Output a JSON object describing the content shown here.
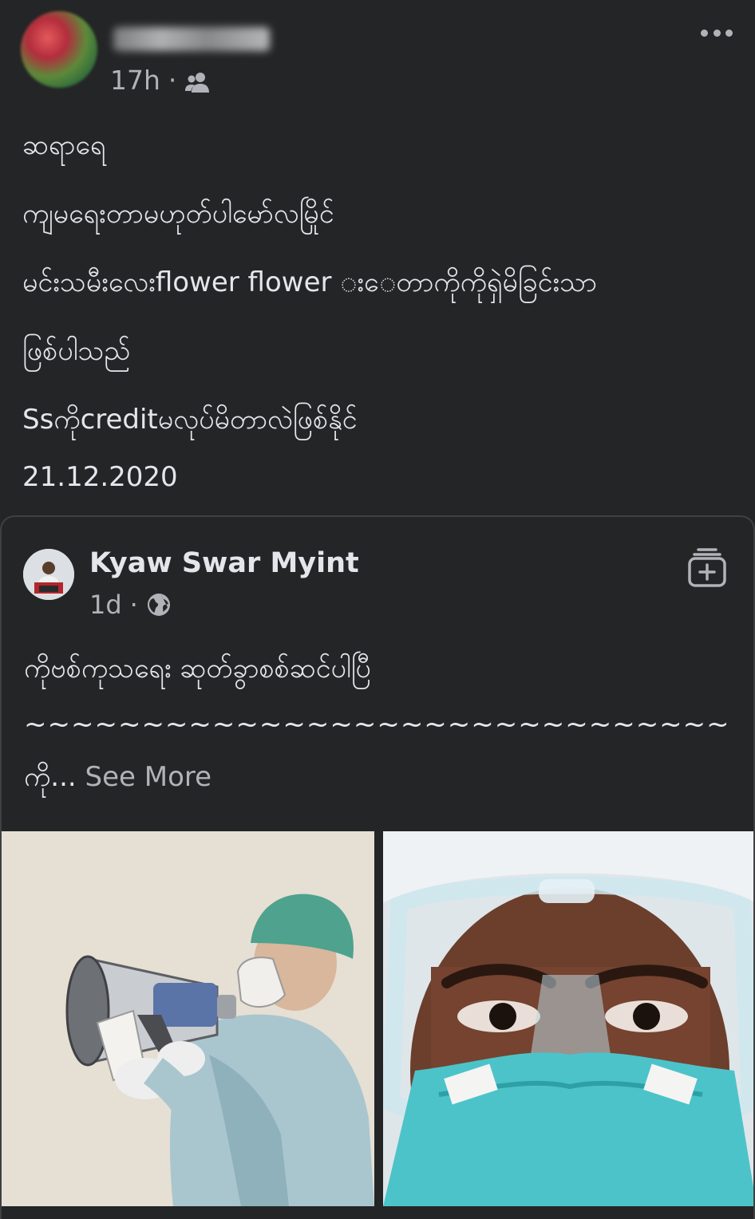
{
  "post": {
    "time": "17h",
    "separator": "·",
    "audience_icon": "friends-icon",
    "more_icon": "more-options-icon",
    "lines": [
      "ဆရာရေ",
      "ကျမရေးတာမဟုတ်ပါမော်လမြိုင်",
      "မင်းသမီးလေးflower flower းေတာကိုကိုရှဲမိခြင်းသာ",
      "ဖြစ်ပါသည်",
      "Ssကိုcreditမလုပ်မိတာလဲဖြစ်နိုင်",
      "21.12.2020"
    ]
  },
  "shared": {
    "author": "Kyaw Swar Myint",
    "time": "1d",
    "separator": "·",
    "audience_icon": "globe-icon",
    "save_icon": "save-collection-icon",
    "line1": "ကိုဗစ်ကုသရေး ဆုတ်ခွာစစ်ဆင်ပါပြီ",
    "line2": "~~~~~~~~~~~~~~~~~~~~~~~~~~~~~~",
    "line3_prefix": "ကို...",
    "see_more": "See More",
    "images": [
      "healthcare-worker-megaphone-illustration",
      "healthcare-worker-goggles-photo"
    ]
  },
  "colors": {
    "background": "#242526",
    "primary_text": "#e4e6eb",
    "secondary_text": "#b0b3b8",
    "border": "#3e4042"
  }
}
